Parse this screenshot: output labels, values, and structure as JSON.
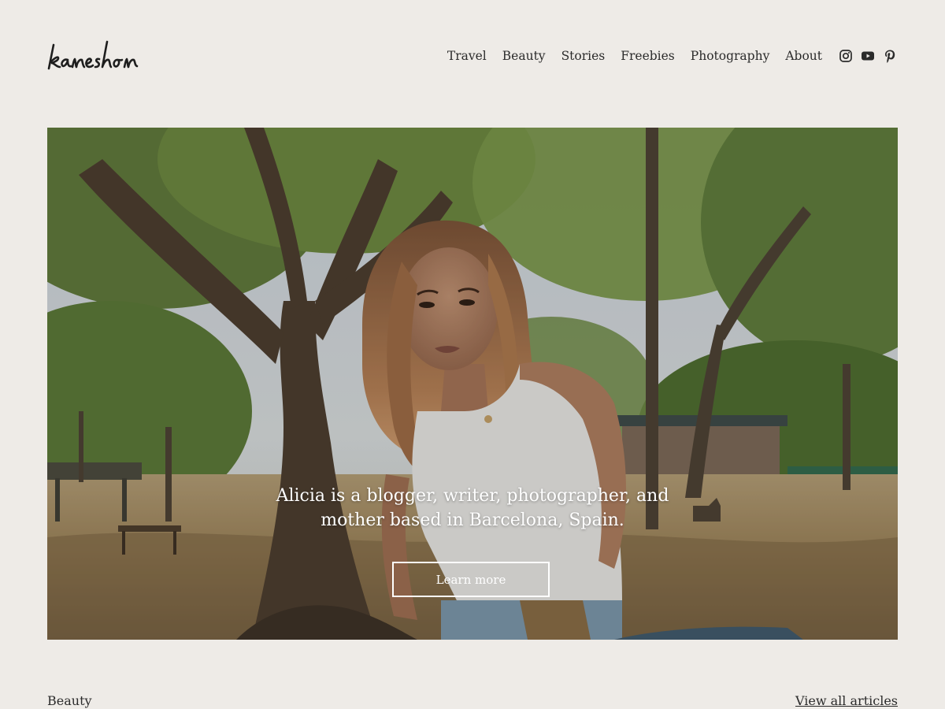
{
  "site": {
    "logo_text": "kaneshon"
  },
  "nav": {
    "items": [
      {
        "label": "Travel"
      },
      {
        "label": "Beauty"
      },
      {
        "label": "Stories"
      },
      {
        "label": "Freebies"
      },
      {
        "label": "Photography"
      },
      {
        "label": "About"
      }
    ],
    "social": [
      {
        "icon": "instagram-icon"
      },
      {
        "icon": "youtube-icon"
      },
      {
        "icon": "pinterest-icon"
      }
    ]
  },
  "hero": {
    "caption": "Alicia is a blogger, writer, photographer, and mother based in Barcelona, Spain.",
    "button_label": "Learn more"
  },
  "section": {
    "title": "Beauty",
    "view_all_label": "View all articles"
  },
  "colors": {
    "background": "#eeebe7",
    "text": "#2b2b2b",
    "button_border": "#ffffff"
  }
}
